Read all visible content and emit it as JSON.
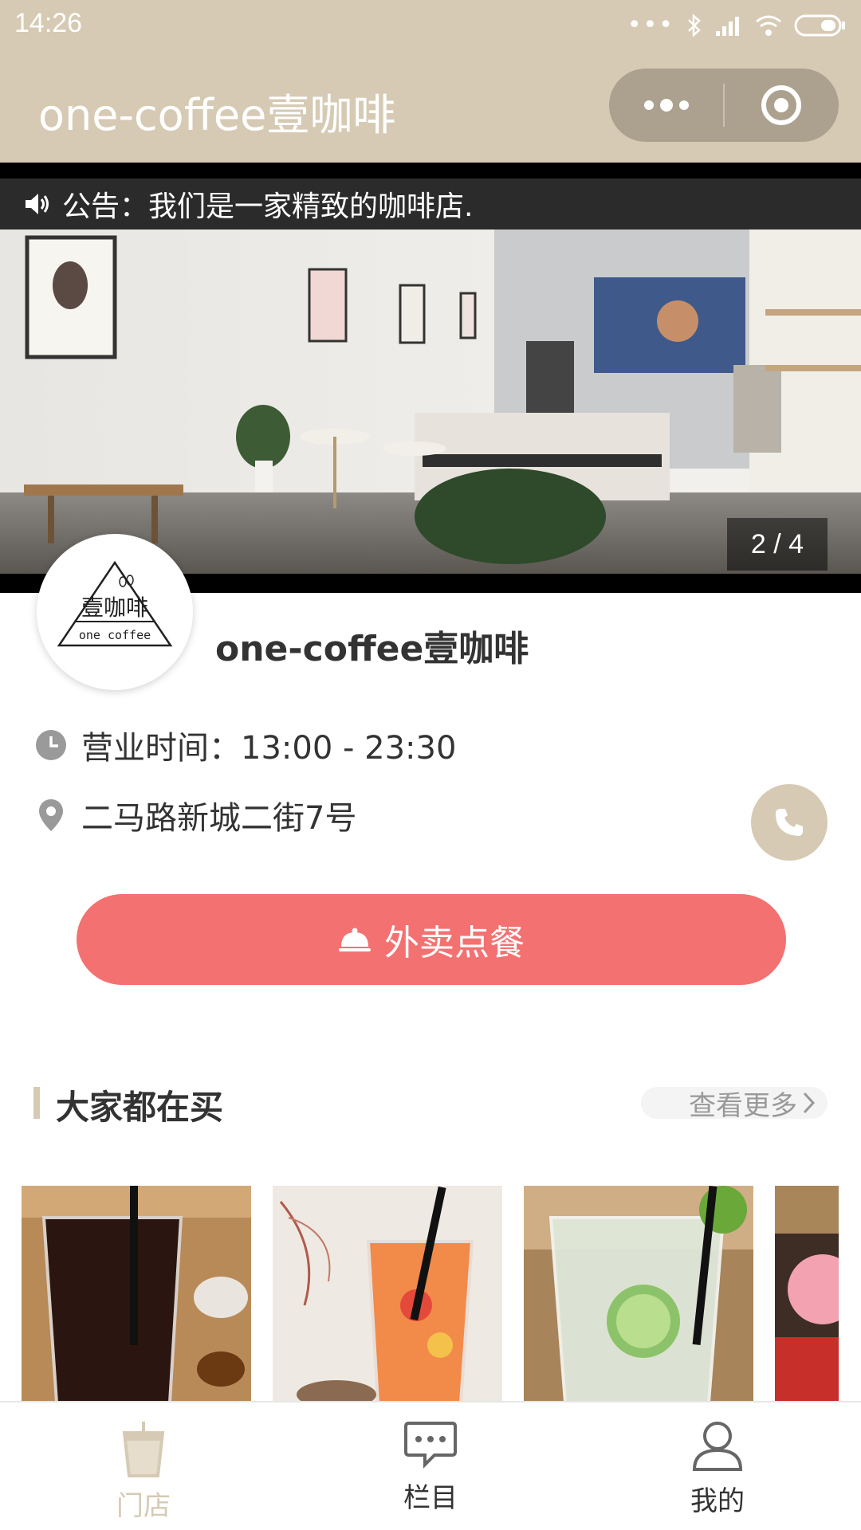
{
  "status_bar": {
    "time": "14:26",
    "dots": "•••"
  },
  "nav": {
    "title": "one-coffee壹咖啡"
  },
  "banner": {
    "notice": "公告：我们是一家精致的咖啡店.",
    "counter": "2 / 4"
  },
  "shop": {
    "logo_text": "壹咖啡",
    "logo_subtext": "one coffee",
    "name": "one-coffee壹咖啡",
    "hours": "营业时间：13:00 - 23:30",
    "address": "二马路新城二街7号"
  },
  "order_button": {
    "label": "外卖点餐"
  },
  "section": {
    "title": "大家都在买",
    "more": "查看更多"
  },
  "tabbar": {
    "items": [
      {
        "label": "门店",
        "icon": "cup-icon",
        "active": true
      },
      {
        "label": "栏目",
        "icon": "chat-icon",
        "active": false
      },
      {
        "label": "我的",
        "icon": "user-icon",
        "active": false
      }
    ]
  },
  "colors": {
    "theme": "#d6cab4",
    "accent": "#f47171",
    "active_tab": "#d6cab4"
  }
}
